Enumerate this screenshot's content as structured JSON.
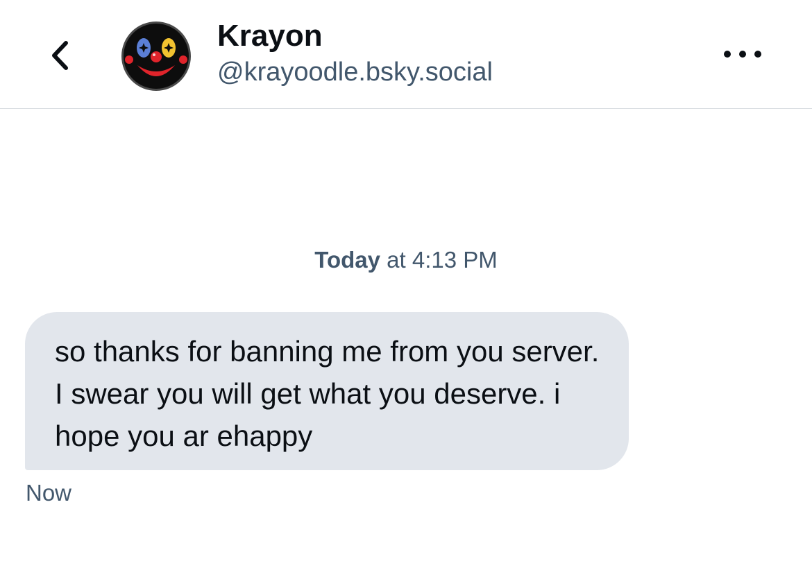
{
  "header": {
    "back_icon": "chevron-left-icon",
    "avatar_icon": "clown-face-avatar",
    "display_name": "Krayon",
    "handle": "@krayoodle.bsky.social",
    "more_icon": "ellipsis-horizontal-icon"
  },
  "conversation": {
    "date_label_day": "Today",
    "date_label_rest": " at 4:13 PM",
    "messages": [
      {
        "text": "so thanks for banning me from you server. I swear you will get what you deserve. i hope you ar ehappy",
        "sent_label": "Now"
      }
    ]
  },
  "colors": {
    "background": "#ffffff",
    "bubble": "#e2e6ec",
    "primary_text": "#0b0f14",
    "secondary_text": "#42576c",
    "divider": "#d9dde2"
  }
}
